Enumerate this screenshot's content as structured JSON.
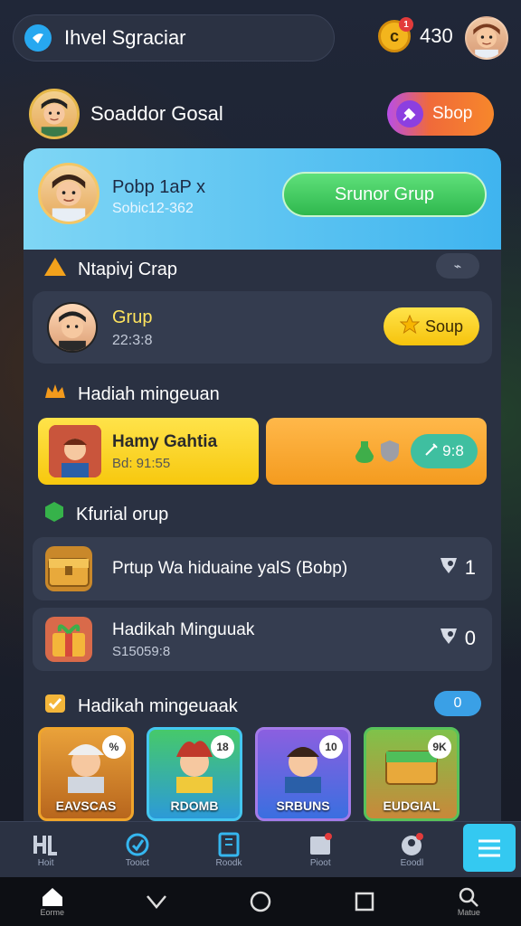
{
  "header": {
    "title": "Ihvel Sgraciar",
    "coins": "430",
    "coin_badge": "1"
  },
  "user": {
    "name": "Soaddor Gosal",
    "shop_label": "Sbop"
  },
  "panel": {
    "profile_name": "Pobp 1aP x",
    "profile_sub": "Sobic12-362",
    "group_button": "Srunor Grup",
    "section1_title": "Ntapivj Crap",
    "group_card": {
      "name": "Grup",
      "time": "22:3:8",
      "button": "Soup"
    },
    "section2_title": "Hadiah mingeuan",
    "reward": {
      "title": "Hamy Gahtia",
      "sub": "Bd: 91:55",
      "value": "9:8"
    },
    "section3_title": "Kfurial orup",
    "items": [
      {
        "text": "Prtup Wa hiduaine yalS (Bobp)",
        "count": "1"
      },
      {
        "text": "Hadikah Minguuak",
        "sub": "S15059:8",
        "count": "0"
      }
    ],
    "section4_title": "Hadikah mingeuaak",
    "section4_badge": "0",
    "tiles": [
      {
        "label": "EAVSCAS",
        "tag": "%",
        "color": "#e0a431"
      },
      {
        "label": "RDOMB",
        "tag": "18",
        "color": "#44c7f0"
      },
      {
        "label": "SRBUNS",
        "tag": "10",
        "color": "#a37be8"
      },
      {
        "label": "EUDGIAL",
        "tag": "9K",
        "color": "#58c25a"
      }
    ]
  },
  "tabs": [
    {
      "label": "Hoit"
    },
    {
      "label": "Tooict"
    },
    {
      "label": "Roodk"
    },
    {
      "label": "Pioot"
    },
    {
      "label": "Eoodl"
    },
    {
      "label": ""
    }
  ],
  "navbar": [
    {
      "label": "Eorme"
    },
    {
      "label": ""
    },
    {
      "label": ""
    },
    {
      "label": ""
    },
    {
      "label": "Matue"
    }
  ]
}
